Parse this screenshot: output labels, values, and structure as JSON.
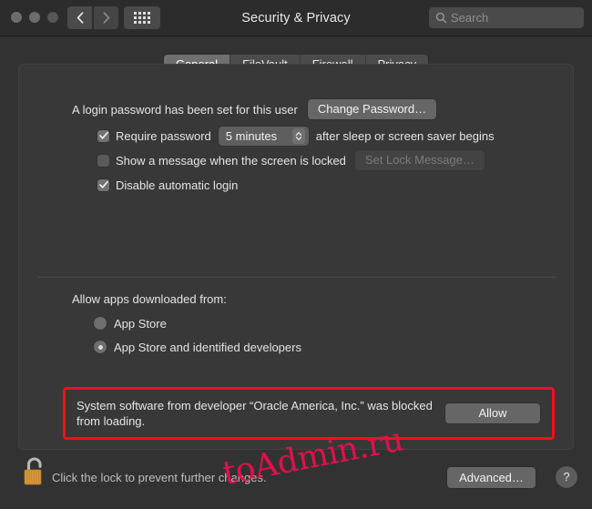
{
  "window": {
    "title": "Security & Privacy",
    "traffic_lights": [
      "close",
      "minimize",
      "zoom"
    ],
    "nav": {
      "back_icon": "chevron-left-icon",
      "forward_icon": "chevron-right-icon",
      "grid_icon": "grid-view-icon"
    },
    "search": {
      "placeholder": "Search",
      "value": "",
      "icon": "search-icon"
    }
  },
  "tabs": [
    {
      "label": "General",
      "active": true
    },
    {
      "label": "FileVault",
      "active": false
    },
    {
      "label": "Firewall",
      "active": false
    },
    {
      "label": "Privacy",
      "active": false
    }
  ],
  "general": {
    "login_password_text": "A login password has been set for this user",
    "change_password_button": "Change Password…",
    "checkboxes": [
      {
        "label": "Require password",
        "checked": true
      },
      {
        "label": "Show a message when the screen is locked",
        "checked": false
      },
      {
        "label": "Disable automatic login",
        "checked": true
      }
    ],
    "require_password_delay": "5 minutes",
    "require_password_suffix": "after sleep or screen saver begins",
    "set_lock_message_button": "Set Lock Message…",
    "set_lock_message_disabled": true,
    "allow_apps_title": "Allow apps downloaded from:",
    "radios": [
      {
        "label": "App Store",
        "selected": false
      },
      {
        "label": "App Store and identified developers",
        "selected": true
      }
    ],
    "blocked_notice": {
      "message": "System software from developer “Oracle America, Inc.” was blocked from loading.",
      "allow_button": "Allow",
      "highlight_color": "#fc0d1b"
    }
  },
  "footer": {
    "lock_icon": "unlocked-padlock-icon",
    "lock_text": "Click the lock to prevent further changes.",
    "advanced_button": "Advanced…",
    "help_button": "?"
  },
  "watermark": {
    "text": "toAdmin.ru",
    "color": "#e0114a"
  }
}
